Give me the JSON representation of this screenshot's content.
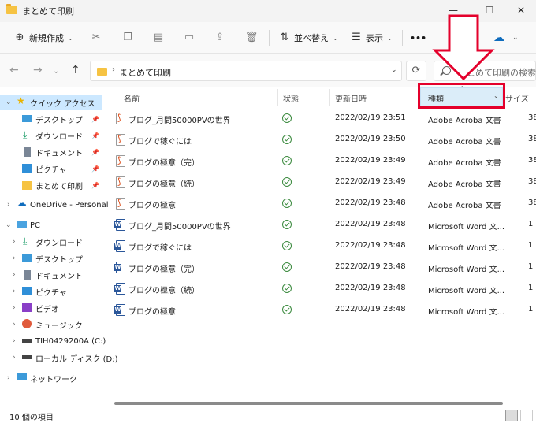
{
  "window": {
    "title": "まとめて印刷"
  },
  "toolbar": {
    "new_label": "新規作成",
    "sort_label": "並べ替え",
    "view_label": "表示",
    "more_label": "•••"
  },
  "address": {
    "path": "まとめて印刷",
    "search_placeholder": "まとめて印刷の検索"
  },
  "sidebar": {
    "quick_access": "クイック アクセス",
    "quick_items": [
      "デスクトップ",
      "ダウンロード",
      "ドキュメント",
      "ピクチャ",
      "まとめて印刷"
    ],
    "onedrive": "OneDrive - Personal",
    "pc": "PC",
    "pc_items": [
      "ダウンロード",
      "デスクトップ",
      "ドキュメント",
      "ピクチャ",
      "ビデオ",
      "ミュージック",
      "TIH0429200A (C:)",
      "ローカル ディスク (D:)"
    ],
    "network": "ネットワーク"
  },
  "columns": {
    "name": "名前",
    "status": "状態",
    "modified": "更新日時",
    "type": "種類",
    "size": "サイズ"
  },
  "files": [
    {
      "name": "ブログ_月間50000PVの世界",
      "modified": "2022/02/19 23:51",
      "type": "Adobe Acroba 文書",
      "size": "38",
      "kind": "pdf"
    },
    {
      "name": "ブログで稼ぐには",
      "modified": "2022/02/19 23:50",
      "type": "Adobe Acroba 文書",
      "size": "38",
      "kind": "pdf"
    },
    {
      "name": "ブログの極意（完）",
      "modified": "2022/02/19 23:49",
      "type": "Adobe Acroba 文書",
      "size": "38",
      "kind": "pdf"
    },
    {
      "name": "ブログの極意（続）",
      "modified": "2022/02/19 23:49",
      "type": "Adobe Acroba 文書",
      "size": "38",
      "kind": "pdf"
    },
    {
      "name": "ブログの極意",
      "modified": "2022/02/19 23:48",
      "type": "Adobe Acroba 文書",
      "size": "38",
      "kind": "pdf"
    },
    {
      "name": "ブログ_月間50000PVの世界",
      "modified": "2022/02/19 23:48",
      "type": "Microsoft Word 文...",
      "size": "1",
      "kind": "word"
    },
    {
      "name": "ブログで稼ぐには",
      "modified": "2022/02/19 23:48",
      "type": "Microsoft Word 文...",
      "size": "1",
      "kind": "word"
    },
    {
      "name": "ブログの極意（完）",
      "modified": "2022/02/19 23:48",
      "type": "Microsoft Word 文...",
      "size": "1",
      "kind": "word"
    },
    {
      "name": "ブログの極意（続）",
      "modified": "2022/02/19 23:48",
      "type": "Microsoft Word 文...",
      "size": "1",
      "kind": "word"
    },
    {
      "name": "ブログの極意",
      "modified": "2022/02/19 23:48",
      "type": "Microsoft Word 文...",
      "size": "1",
      "kind": "word"
    }
  ],
  "status_bar": {
    "item_count": "10 個の項目"
  },
  "colors": {
    "selection": "#cce8ff",
    "header_highlight": "#dbedf9",
    "annotation": "#e4002b",
    "folder": "#f6c343",
    "word": "#2b579a",
    "pdf": "#d83b01",
    "ok": "#3b8a3e"
  }
}
